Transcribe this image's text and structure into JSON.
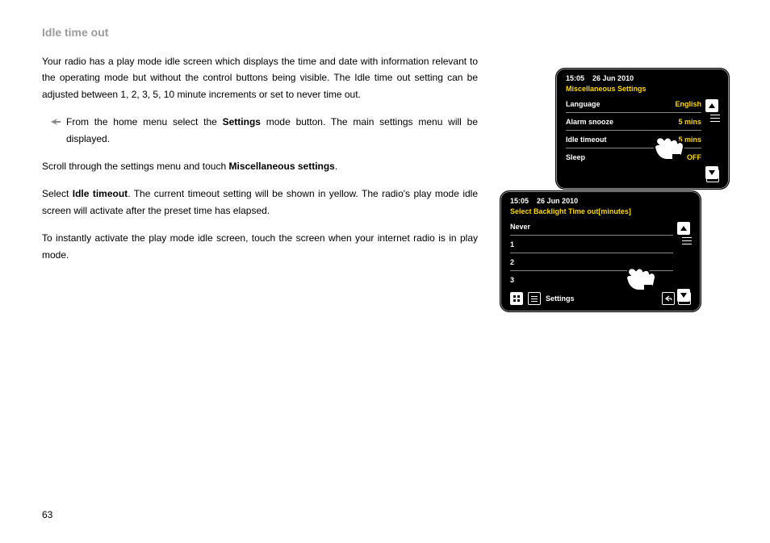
{
  "title": "Idle time out",
  "paragraphs": {
    "intro": "Your radio has a play mode idle screen which displays the time and date with information relevant to the operating mode but without the control buttons being visible. The Idle time out setting can be adjusted between 1, 2, 3, 5, 10 minute increments or set to never time out.",
    "step1_a": "From the home menu select the ",
    "step1_bold": "Settings",
    "step1_b": " mode button. The main settings menu will be displayed.",
    "p2_a": "Scroll through the settings menu and touch ",
    "p2_bold": "Miscellaneous settings",
    "p2_b": ".",
    "p3_a": "Select ",
    "p3_bold": "Idle timeout",
    "p3_b": ". The current timeout setting will be shown in yellow. The radio's play mode idle screen will activate after the preset time has elapsed.",
    "p4": "To instantly activate the play mode idle screen, touch the screen when your internet radio is in play mode."
  },
  "page_number": "63",
  "screen1": {
    "time": "15:05",
    "date": "26 Jun 2010",
    "title": "Miscellaneous Settings",
    "rows": [
      {
        "label": "Language",
        "value": "English"
      },
      {
        "label": "Alarm snooze",
        "value": "5 mins"
      },
      {
        "label": "Idle timeout",
        "value": "5 mins"
      },
      {
        "label": "Sleep",
        "value": "OFF"
      }
    ]
  },
  "screen2": {
    "time": "15:05",
    "date": "26 Jun 2010",
    "title": "Select Backlight Time out[minutes]",
    "rows": [
      {
        "label": "Never",
        "value": ""
      },
      {
        "label": "1",
        "value": ""
      },
      {
        "label": "2",
        "value": ""
      },
      {
        "label": "3",
        "value": ""
      }
    ],
    "bottom_label": "Settings"
  }
}
